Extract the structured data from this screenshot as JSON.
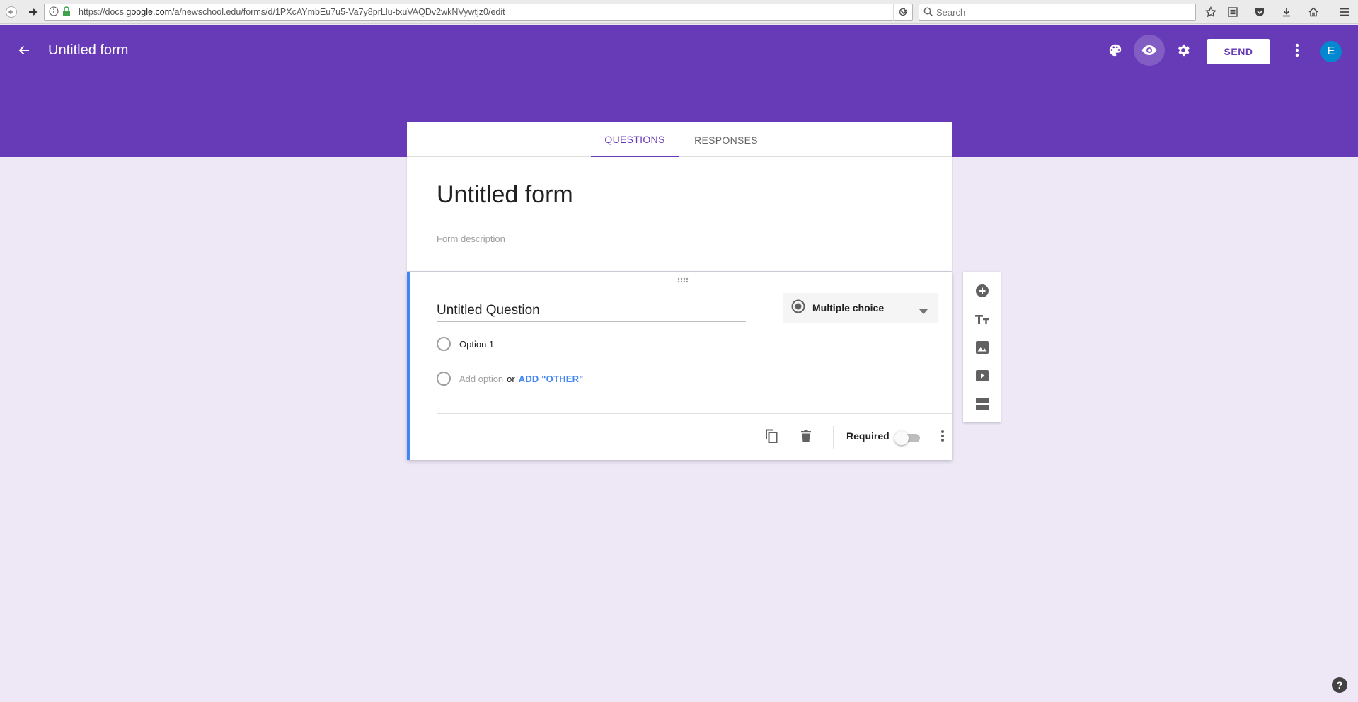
{
  "browser": {
    "url_prefix": "https://docs.",
    "url_domain": "google.com",
    "url_path": "/a/newschool.edu/forms/d/1PXcAYmbEu7u5-Va7y8prLlu-txuVAQDv2wkNVywtjz0/edit",
    "search_placeholder": "Search"
  },
  "header": {
    "title": "Untitled form",
    "send_label": "SEND",
    "avatar_initial": "E",
    "bg_color": "#673ab7"
  },
  "tabs": [
    {
      "label": "QUESTIONS",
      "active": true
    },
    {
      "label": "RESPONSES",
      "active": false
    }
  ],
  "form": {
    "title": "Untitled form",
    "description_placeholder": "Form description"
  },
  "question": {
    "title": "Untitled Question",
    "type_label": "Multiple choice",
    "options": [
      "Option 1"
    ],
    "add_option_label": "Add option",
    "or_label": "or",
    "add_other_label": "ADD \"OTHER\"",
    "required_label": "Required",
    "required": false
  },
  "side_toolbar": [
    "add-question-icon",
    "add-title-icon",
    "add-image-icon",
    "add-video-icon",
    "add-section-icon"
  ],
  "help_label": "?"
}
